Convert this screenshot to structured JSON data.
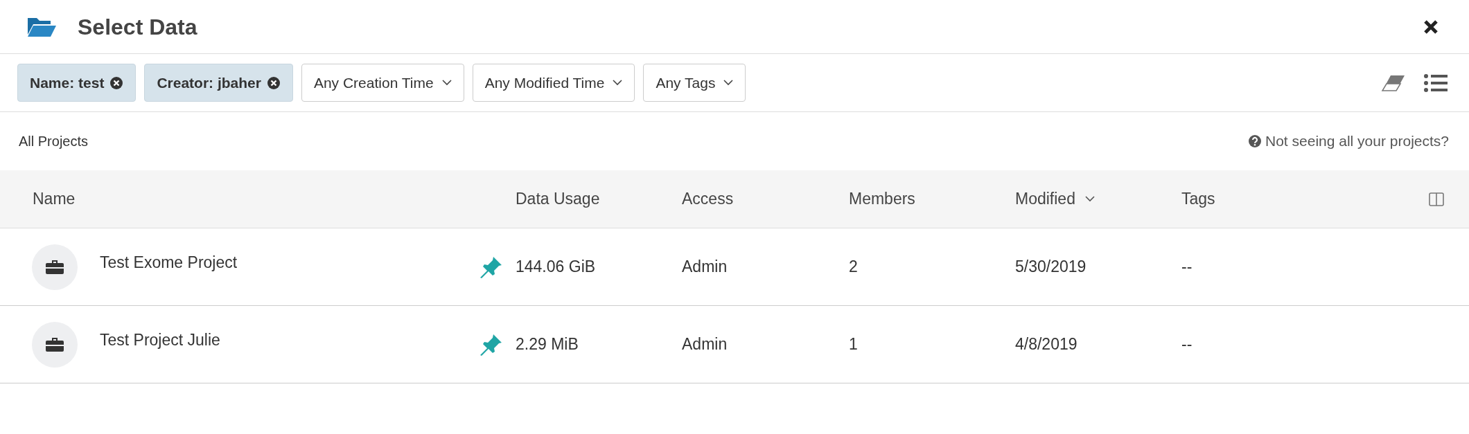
{
  "dialog": {
    "title": "Select Data"
  },
  "filters": [
    {
      "kind": "chip",
      "label": "Name: test"
    },
    {
      "kind": "chip",
      "label": "Creator: jbaher"
    },
    {
      "kind": "dropdown",
      "label": "Any Creation Time"
    },
    {
      "kind": "dropdown",
      "label": "Any Modified Time"
    },
    {
      "kind": "dropdown",
      "label": "Any Tags"
    }
  ],
  "section": {
    "title": "All Projects",
    "help_link": "Not seeing all your projects?"
  },
  "table": {
    "columns": [
      {
        "label": "Name",
        "sorted": false
      },
      {
        "label": "Data Usage",
        "sorted": false
      },
      {
        "label": "Access",
        "sorted": false
      },
      {
        "label": "Members",
        "sorted": false
      },
      {
        "label": "Modified",
        "sorted": true
      },
      {
        "label": "Tags",
        "sorted": false
      }
    ],
    "rows": [
      {
        "name": "Test Exome Project",
        "pinned": true,
        "data_usage": "144.06 GiB",
        "access": "Admin",
        "members": "2",
        "modified": "5/30/2019",
        "tags": "--"
      },
      {
        "name": "Test Project Julie",
        "pinned": true,
        "data_usage": "2.29 MiB",
        "access": "Admin",
        "members": "1",
        "modified": "4/8/2019",
        "tags": "--"
      }
    ]
  }
}
